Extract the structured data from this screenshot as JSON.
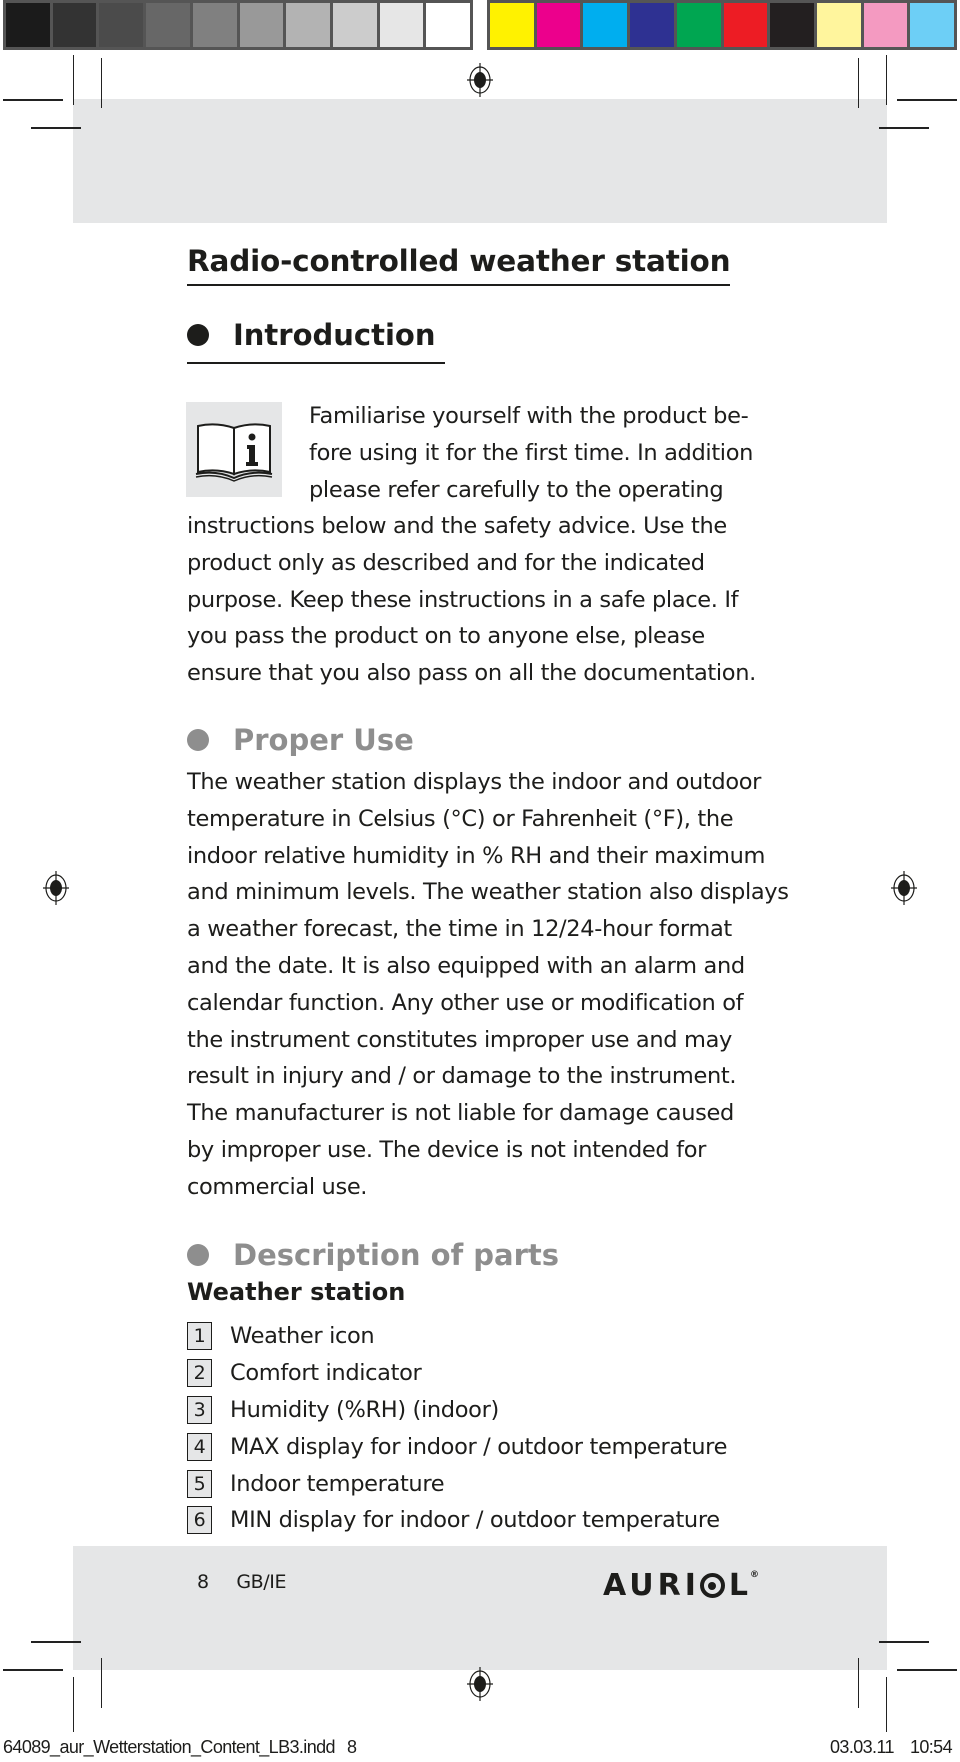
{
  "print_marks": {
    "grey_swatches": [
      "#1b1b1b",
      "#333333",
      "#4b4b4b",
      "#676767",
      "#808080",
      "#999999",
      "#b3b3b3",
      "#cccccc",
      "#e6e6e6",
      "#ffffff"
    ],
    "color_swatches": [
      "#fff200",
      "#ec008c",
      "#00aeef",
      "#2e3192",
      "#00a651",
      "#ed1c24",
      "#231f20",
      "#fff59d",
      "#f49ac1",
      "#6dcff6"
    ]
  },
  "document": {
    "title": "Radio-controlled weather station",
    "sections": {
      "introduction": {
        "heading": "Introduction",
        "icon": "info-book-icon",
        "lines": [
          "Familiarise yourself with the product be-",
          "fore using it for the first time. In addition",
          "please refer carefully to the operating",
          "instructions below and the safety advice. Use the",
          "product only as described and for the indicated",
          "purpose. Keep these instructions in a safe place. If",
          "you pass the product on to anyone else, please",
          "ensure that you also pass on all the documentation."
        ]
      },
      "proper_use": {
        "heading": "Proper Use",
        "lines": [
          "The weather station displays the indoor and outdoor",
          "temperature in Celsius (°C) or Fahrenheit (°F), the",
          "indoor relative humidity in % RH and their maximum",
          "and minimum levels. The weather station also displays",
          "a weather forecast, the time in 12/24-hour format",
          "and the date. It is also equipped with an alarm and",
          "calendar function. Any other use or modification of",
          "the instrument constitutes improper use and may",
          "result in injury and / or damage to the instrument.",
          "The manufacturer is not liable for damage caused",
          "by improper use. The device is not intended for",
          "commercial use."
        ]
      },
      "description_of_parts": {
        "heading": "Description of parts",
        "subheading": "Weather station",
        "parts": [
          {
            "num": "1",
            "label": "Weather icon"
          },
          {
            "num": "2",
            "label": "Comfort indicator"
          },
          {
            "num": "3",
            "label": "Humidity (%RH) (indoor)"
          },
          {
            "num": "4",
            "label": "MAX display for indoor / outdoor temperature"
          },
          {
            "num": "5",
            "label": "Indoor temperature"
          },
          {
            "num": "6",
            "label": "MIN display for indoor / outdoor temperature"
          }
        ]
      }
    }
  },
  "footer": {
    "page_number": "8",
    "language": "GB/IE",
    "brand": {
      "pre": "AURI",
      "post": "L",
      "registered": "®"
    }
  },
  "slug": {
    "filename": "64089_aur_Wetterstation_Content_LB3.indd",
    "page": "8",
    "date": "03.03.11",
    "time": "10:54"
  },
  "colors": {
    "text": "#1d1d1b",
    "section_grey": "#8e8e8e",
    "panel_grey": "#e5e6e7"
  }
}
